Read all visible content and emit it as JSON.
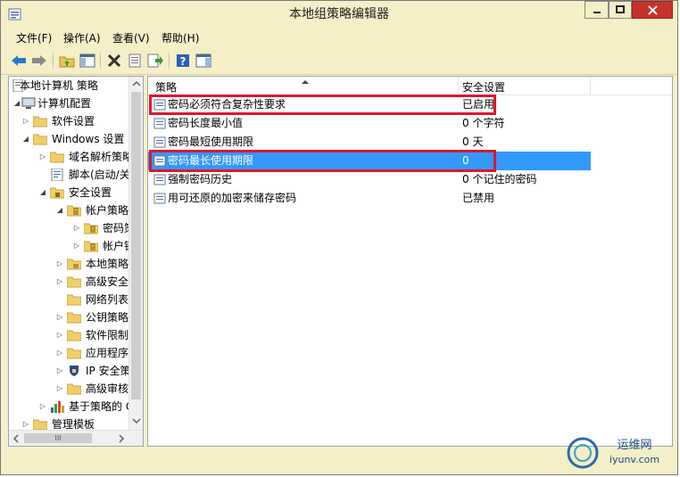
{
  "window": {
    "title": "本地组策略编辑器"
  },
  "menu": {
    "items": [
      "文件(F)",
      "操作(A)",
      "查看(V)",
      "帮助(H)"
    ]
  },
  "tree": {
    "items": [
      {
        "label": "本地计算机 策略",
        "level": 0
      },
      {
        "label": "计算机配置",
        "level": 1
      },
      {
        "label": "软件设置",
        "level": 2
      },
      {
        "label": "Windows 设置",
        "level": 2
      },
      {
        "label": "域名解析策略",
        "level": 3
      },
      {
        "label": "脚本(启动/关",
        "level": 3
      },
      {
        "label": "安全设置",
        "level": 3
      },
      {
        "label": "帐户策略",
        "level": 4
      },
      {
        "label": "密码策",
        "level": 5
      },
      {
        "label": "帐户锁",
        "level": 5
      },
      {
        "label": "本地策略",
        "level": 4
      },
      {
        "label": "高级安全",
        "level": 4
      },
      {
        "label": "网络列表",
        "level": 4
      },
      {
        "label": "公钥策略",
        "level": 4
      },
      {
        "label": "软件限制",
        "level": 4
      },
      {
        "label": "应用程序",
        "level": 4
      },
      {
        "label": "IP 安全策",
        "level": 4
      },
      {
        "label": "高级审核",
        "level": 4
      },
      {
        "label": "基于策略的 C",
        "level": 2
      },
      {
        "label": "管理模板",
        "level": 1
      }
    ],
    "scrollbar_thumb": "III"
  },
  "list": {
    "columns": [
      "策略",
      "安全设置"
    ],
    "rows": [
      {
        "name": "密码必须符合复杂性要求",
        "setting": "已启用"
      },
      {
        "name": "密码长度最小值",
        "setting": "0 个字符"
      },
      {
        "name": "密码最短使用期限",
        "setting": "0 天"
      },
      {
        "name": "密码最长使用期限",
        "setting": "0"
      },
      {
        "name": "强制密码历史",
        "setting": "0 个记住的密码"
      },
      {
        "name": "用可还原的加密来储存密码",
        "setting": "已禁用"
      }
    ],
    "selected_index": 3
  },
  "watermark": {
    "text1": "运维网",
    "text2": "iyunv.com"
  },
  "colors": {
    "highlight": "#3399ff",
    "red_box": "#e0172b",
    "chrome": "#f4efc6"
  }
}
